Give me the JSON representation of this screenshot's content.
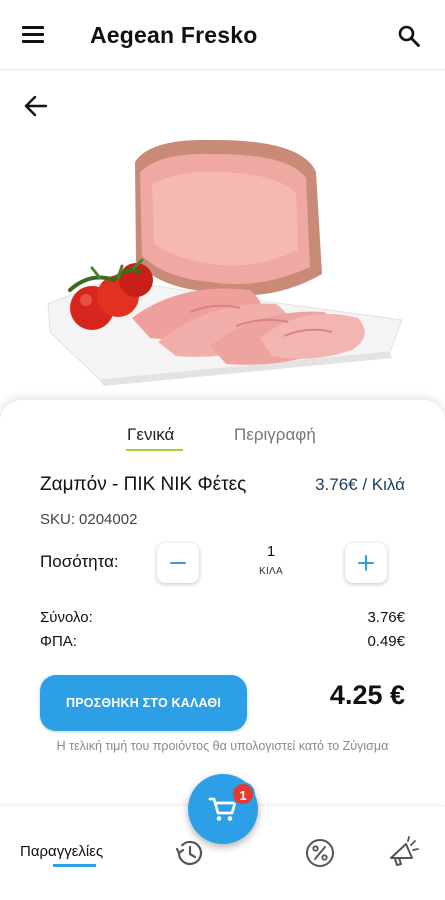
{
  "header": {
    "title": "Aegean Fresko",
    "menu_icon": "hamburger-menu-icon",
    "search_icon": "search-icon"
  },
  "navigation": {
    "back_icon": "arrow-left-icon"
  },
  "product": {
    "image": "ham-slices-with-tomatoes",
    "name": "Ζαμπόν - ΠΙΚ ΝΙΚ Φέτες",
    "price": "3.76€ / Κιλά",
    "sku_label": "SKU:",
    "sku_value": "0204002"
  },
  "tabs": [
    {
      "label": "Γενικά",
      "active": true
    },
    {
      "label": "Περιγραφή",
      "active": false
    }
  ],
  "quantity": {
    "label": "Ποσότητα:",
    "value": "1",
    "unit": "ΚΙΛΑ"
  },
  "summary": {
    "total_label": "Σύνολο:",
    "total_value": "3.76€",
    "vat_label": "ΦΠΑ:",
    "vat_value": "0.49€",
    "grand_total": "4.25 €"
  },
  "actions": {
    "add_to_cart": "ΠΡΟΣΘΗΚΗ ΣΤΟ ΚΑΛΑΘΙ"
  },
  "note": "Η τελική τιμή του προιόντος θα υπολογιστεί κατό το Ζύγισμα",
  "bottom_nav": {
    "orders_label": "Παραγγελίες",
    "items": [
      {
        "icon": "history-icon"
      },
      {
        "icon": "percent-offer-icon"
      },
      {
        "icon": "megaphone-icon"
      }
    ],
    "cart_icon": "cart-icon",
    "cart_badge": "1"
  },
  "colors": {
    "primary": "#2d9fe6",
    "price": "#1b3f63",
    "tab_accent": "#a5cf3b",
    "badge": "#e53935"
  }
}
